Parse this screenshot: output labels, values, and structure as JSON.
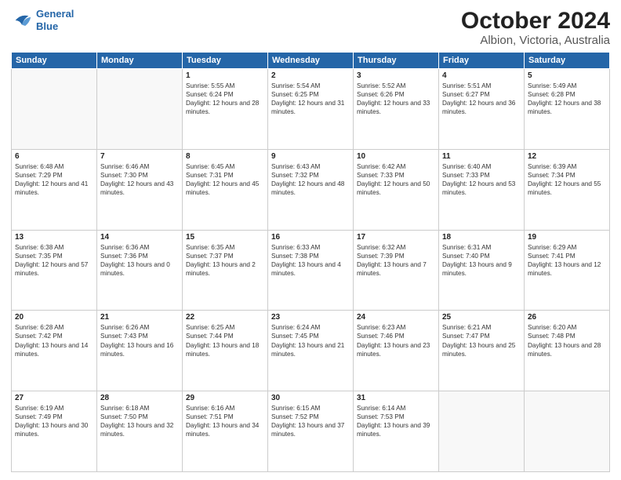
{
  "header": {
    "logo_line1": "General",
    "logo_line2": "Blue",
    "title": "October 2024",
    "subtitle": "Albion, Victoria, Australia"
  },
  "days_of_week": [
    "Sunday",
    "Monday",
    "Tuesday",
    "Wednesday",
    "Thursday",
    "Friday",
    "Saturday"
  ],
  "weeks": [
    [
      {
        "day": "",
        "sunrise": "",
        "sunset": "",
        "daylight": ""
      },
      {
        "day": "",
        "sunrise": "",
        "sunset": "",
        "daylight": ""
      },
      {
        "day": "1",
        "sunrise": "Sunrise: 5:55 AM",
        "sunset": "Sunset: 6:24 PM",
        "daylight": "Daylight: 12 hours and 28 minutes."
      },
      {
        "day": "2",
        "sunrise": "Sunrise: 5:54 AM",
        "sunset": "Sunset: 6:25 PM",
        "daylight": "Daylight: 12 hours and 31 minutes."
      },
      {
        "day": "3",
        "sunrise": "Sunrise: 5:52 AM",
        "sunset": "Sunset: 6:26 PM",
        "daylight": "Daylight: 12 hours and 33 minutes."
      },
      {
        "day": "4",
        "sunrise": "Sunrise: 5:51 AM",
        "sunset": "Sunset: 6:27 PM",
        "daylight": "Daylight: 12 hours and 36 minutes."
      },
      {
        "day": "5",
        "sunrise": "Sunrise: 5:49 AM",
        "sunset": "Sunset: 6:28 PM",
        "daylight": "Daylight: 12 hours and 38 minutes."
      }
    ],
    [
      {
        "day": "6",
        "sunrise": "Sunrise: 6:48 AM",
        "sunset": "Sunset: 7:29 PM",
        "daylight": "Daylight: 12 hours and 41 minutes."
      },
      {
        "day": "7",
        "sunrise": "Sunrise: 6:46 AM",
        "sunset": "Sunset: 7:30 PM",
        "daylight": "Daylight: 12 hours and 43 minutes."
      },
      {
        "day": "8",
        "sunrise": "Sunrise: 6:45 AM",
        "sunset": "Sunset: 7:31 PM",
        "daylight": "Daylight: 12 hours and 45 minutes."
      },
      {
        "day": "9",
        "sunrise": "Sunrise: 6:43 AM",
        "sunset": "Sunset: 7:32 PM",
        "daylight": "Daylight: 12 hours and 48 minutes."
      },
      {
        "day": "10",
        "sunrise": "Sunrise: 6:42 AM",
        "sunset": "Sunset: 7:33 PM",
        "daylight": "Daylight: 12 hours and 50 minutes."
      },
      {
        "day": "11",
        "sunrise": "Sunrise: 6:40 AM",
        "sunset": "Sunset: 7:33 PM",
        "daylight": "Daylight: 12 hours and 53 minutes."
      },
      {
        "day": "12",
        "sunrise": "Sunrise: 6:39 AM",
        "sunset": "Sunset: 7:34 PM",
        "daylight": "Daylight: 12 hours and 55 minutes."
      }
    ],
    [
      {
        "day": "13",
        "sunrise": "Sunrise: 6:38 AM",
        "sunset": "Sunset: 7:35 PM",
        "daylight": "Daylight: 12 hours and 57 minutes."
      },
      {
        "day": "14",
        "sunrise": "Sunrise: 6:36 AM",
        "sunset": "Sunset: 7:36 PM",
        "daylight": "Daylight: 13 hours and 0 minutes."
      },
      {
        "day": "15",
        "sunrise": "Sunrise: 6:35 AM",
        "sunset": "Sunset: 7:37 PM",
        "daylight": "Daylight: 13 hours and 2 minutes."
      },
      {
        "day": "16",
        "sunrise": "Sunrise: 6:33 AM",
        "sunset": "Sunset: 7:38 PM",
        "daylight": "Daylight: 13 hours and 4 minutes."
      },
      {
        "day": "17",
        "sunrise": "Sunrise: 6:32 AM",
        "sunset": "Sunset: 7:39 PM",
        "daylight": "Daylight: 13 hours and 7 minutes."
      },
      {
        "day": "18",
        "sunrise": "Sunrise: 6:31 AM",
        "sunset": "Sunset: 7:40 PM",
        "daylight": "Daylight: 13 hours and 9 minutes."
      },
      {
        "day": "19",
        "sunrise": "Sunrise: 6:29 AM",
        "sunset": "Sunset: 7:41 PM",
        "daylight": "Daylight: 13 hours and 12 minutes."
      }
    ],
    [
      {
        "day": "20",
        "sunrise": "Sunrise: 6:28 AM",
        "sunset": "Sunset: 7:42 PM",
        "daylight": "Daylight: 13 hours and 14 minutes."
      },
      {
        "day": "21",
        "sunrise": "Sunrise: 6:26 AM",
        "sunset": "Sunset: 7:43 PM",
        "daylight": "Daylight: 13 hours and 16 minutes."
      },
      {
        "day": "22",
        "sunrise": "Sunrise: 6:25 AM",
        "sunset": "Sunset: 7:44 PM",
        "daylight": "Daylight: 13 hours and 18 minutes."
      },
      {
        "day": "23",
        "sunrise": "Sunrise: 6:24 AM",
        "sunset": "Sunset: 7:45 PM",
        "daylight": "Daylight: 13 hours and 21 minutes."
      },
      {
        "day": "24",
        "sunrise": "Sunrise: 6:23 AM",
        "sunset": "Sunset: 7:46 PM",
        "daylight": "Daylight: 13 hours and 23 minutes."
      },
      {
        "day": "25",
        "sunrise": "Sunrise: 6:21 AM",
        "sunset": "Sunset: 7:47 PM",
        "daylight": "Daylight: 13 hours and 25 minutes."
      },
      {
        "day": "26",
        "sunrise": "Sunrise: 6:20 AM",
        "sunset": "Sunset: 7:48 PM",
        "daylight": "Daylight: 13 hours and 28 minutes."
      }
    ],
    [
      {
        "day": "27",
        "sunrise": "Sunrise: 6:19 AM",
        "sunset": "Sunset: 7:49 PM",
        "daylight": "Daylight: 13 hours and 30 minutes."
      },
      {
        "day": "28",
        "sunrise": "Sunrise: 6:18 AM",
        "sunset": "Sunset: 7:50 PM",
        "daylight": "Daylight: 13 hours and 32 minutes."
      },
      {
        "day": "29",
        "sunrise": "Sunrise: 6:16 AM",
        "sunset": "Sunset: 7:51 PM",
        "daylight": "Daylight: 13 hours and 34 minutes."
      },
      {
        "day": "30",
        "sunrise": "Sunrise: 6:15 AM",
        "sunset": "Sunset: 7:52 PM",
        "daylight": "Daylight: 13 hours and 37 minutes."
      },
      {
        "day": "31",
        "sunrise": "Sunrise: 6:14 AM",
        "sunset": "Sunset: 7:53 PM",
        "daylight": "Daylight: 13 hours and 39 minutes."
      },
      {
        "day": "",
        "sunrise": "",
        "sunset": "",
        "daylight": ""
      },
      {
        "day": "",
        "sunrise": "",
        "sunset": "",
        "daylight": ""
      }
    ]
  ]
}
